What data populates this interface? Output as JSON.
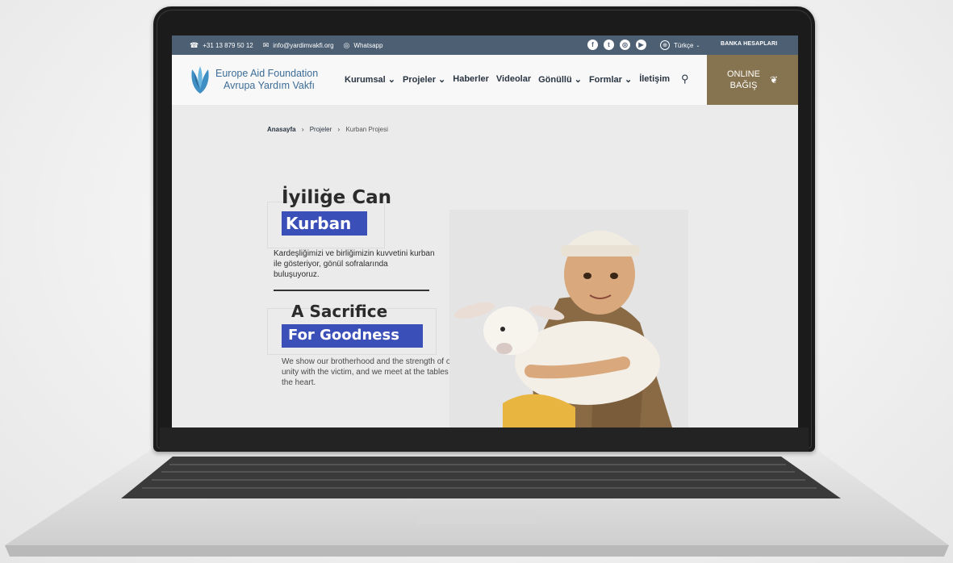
{
  "topbar": {
    "phone": "+31 13 879 50 12",
    "email": "info@yardimvakfi.org",
    "whatsapp": "Whatsapp",
    "social": [
      "facebook-icon",
      "twitter-icon",
      "instagram-icon",
      "youtube-icon"
    ],
    "language": "Türkçe",
    "bank_accounts": "BANKA HESAPLARI"
  },
  "logo": {
    "line1": "Europe Aid Foundation",
    "line2": "Avrupa Yardım Vakfı"
  },
  "menu": [
    {
      "label": "Kurumsal ⌄"
    },
    {
      "label": "Projeler ⌄"
    },
    {
      "label": "Haberler"
    },
    {
      "label": "Videolar"
    },
    {
      "label": "Gönüllü ⌄"
    },
    {
      "label": "Formlar ⌄"
    },
    {
      "label": "İletişim"
    }
  ],
  "donate": {
    "line1": "ONLINE",
    "line2": "BAĞIŞ"
  },
  "breadcrumb": {
    "home": "Anasayfa",
    "projects": "Projeler",
    "current": "Kurban Projesi"
  },
  "hero": {
    "tr_title": "İyiliğe Can",
    "tr_highlight": "Kurban",
    "tr_text": "Kardeşliğimizi ve birliğimizin kuvvetini kurban ile gösteriyor, gönül sofralarında buluşuyoruz.",
    "en_title": "A Sacrifice",
    "en_highlight": "For Goodness",
    "en_text": "We show our brotherhood and the strength of our unity with the victim, and we meet at the tables of the heart."
  },
  "colors": {
    "topbar": "#4d5f73",
    "accent": "#3b4fb8",
    "donate": "#86734f",
    "logo": "#3c6c97"
  }
}
